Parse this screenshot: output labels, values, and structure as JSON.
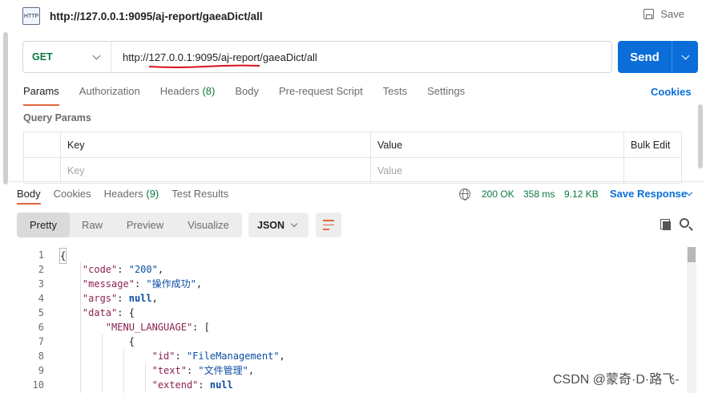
{
  "request": {
    "title": "http://127.0.0.1:9095/aj-report/gaeaDict/all",
    "icon_text": "HTTP",
    "save_label": "Save",
    "method": "GET",
    "url": "http://127.0.0.1:9095/aj-report/gaeaDict/all",
    "send_label": "Send"
  },
  "request_tabs": [
    {
      "label": "Params"
    },
    {
      "label": "Authorization"
    },
    {
      "label": "Headers",
      "count": "(8)"
    },
    {
      "label": "Body"
    },
    {
      "label": "Pre-request Script"
    },
    {
      "label": "Tests"
    },
    {
      "label": "Settings"
    }
  ],
  "cookies_label": "Cookies",
  "query_params": {
    "label": "Query Params",
    "headers": {
      "key": "Key",
      "value": "Value",
      "bulk_edit": "Bulk Edit"
    },
    "placeholders": {
      "key": "Key",
      "value": "Value"
    }
  },
  "response_tabs": [
    {
      "label": "Body"
    },
    {
      "label": "Cookies"
    },
    {
      "label": "Headers",
      "count": "(9)"
    },
    {
      "label": "Test Results"
    }
  ],
  "response_stats": {
    "status": "200 OK",
    "time": "358 ms",
    "size": "9.12 KB",
    "save_response": "Save Response"
  },
  "format_options": {
    "pretty": "Pretty",
    "raw": "Raw",
    "preview": "Preview",
    "visualize": "Visualize",
    "language": "JSON"
  },
  "code_lines": [
    {
      "n": "1",
      "text": "{"
    },
    {
      "n": "2",
      "text": "    \"code\": \"200\","
    },
    {
      "n": "3",
      "text": "    \"message\": \"操作成功\","
    },
    {
      "n": "4",
      "text": "    \"args\": null,"
    },
    {
      "n": "5",
      "text": "    \"data\": {"
    },
    {
      "n": "6",
      "text": "        \"MENU_LANGUAGE\": ["
    },
    {
      "n": "7",
      "text": "            {"
    },
    {
      "n": "8",
      "text": "                \"id\": \"FileManagement\","
    },
    {
      "n": "9",
      "text": "                \"text\": \"文件管理\","
    },
    {
      "n": "10",
      "text": "                \"extend\": null"
    }
  ],
  "watermark": "CSDN @蒙奇·D·路飞-",
  "colors": {
    "accent_blue": "#0b6ed8",
    "tab_underline": "#e2673f",
    "success_green": "#0a7a3f"
  }
}
